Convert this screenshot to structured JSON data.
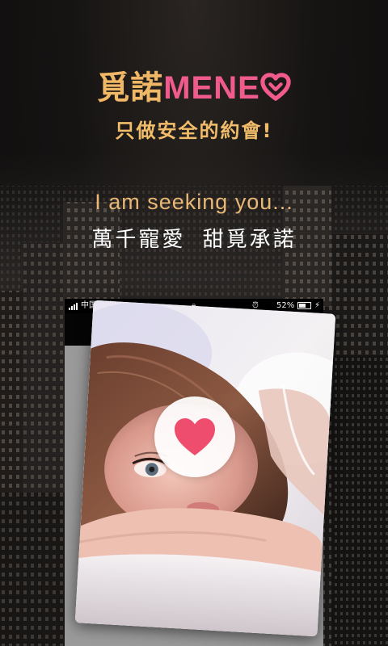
{
  "brand": {
    "name_cn": "覓諾",
    "name_en": "MENE"
  },
  "tagline": "只做安全的約會!",
  "seeking": "I am seeking you...",
  "slogan": "萬千寵愛 甜覓承諾",
  "status_bar": {
    "carrier": "中国移动",
    "battery_pct": "52%",
    "battery_level": 0.52
  },
  "colors": {
    "brand_gold": "#f0b866",
    "brand_pink": "#f05a8d",
    "heart_red": "#ee4d6e"
  },
  "icons": {
    "like": "heart-icon",
    "logo_heart": "heart-outline-icon"
  }
}
